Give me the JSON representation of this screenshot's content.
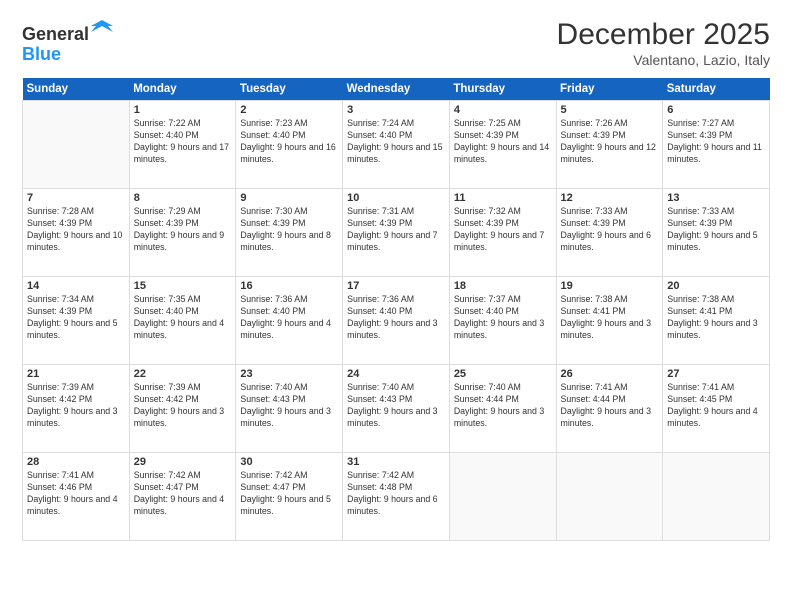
{
  "logo": {
    "general": "General",
    "blue": "Blue"
  },
  "header": {
    "month": "December 2025",
    "location": "Valentano, Lazio, Italy"
  },
  "weekdays": [
    "Sunday",
    "Monday",
    "Tuesday",
    "Wednesday",
    "Thursday",
    "Friday",
    "Saturday"
  ],
  "days": [
    {
      "date": "",
      "info": ""
    },
    {
      "date": "1",
      "info": "Sunrise: 7:22 AM\nSunset: 4:40 PM\nDaylight: 9 hours\nand 17 minutes."
    },
    {
      "date": "2",
      "info": "Sunrise: 7:23 AM\nSunset: 4:40 PM\nDaylight: 9 hours\nand 16 minutes."
    },
    {
      "date": "3",
      "info": "Sunrise: 7:24 AM\nSunset: 4:40 PM\nDaylight: 9 hours\nand 15 minutes."
    },
    {
      "date": "4",
      "info": "Sunrise: 7:25 AM\nSunset: 4:39 PM\nDaylight: 9 hours\nand 14 minutes."
    },
    {
      "date": "5",
      "info": "Sunrise: 7:26 AM\nSunset: 4:39 PM\nDaylight: 9 hours\nand 12 minutes."
    },
    {
      "date": "6",
      "info": "Sunrise: 7:27 AM\nSunset: 4:39 PM\nDaylight: 9 hours\nand 11 minutes."
    },
    {
      "date": "7",
      "info": "Sunrise: 7:28 AM\nSunset: 4:39 PM\nDaylight: 9 hours\nand 10 minutes."
    },
    {
      "date": "8",
      "info": "Sunrise: 7:29 AM\nSunset: 4:39 PM\nDaylight: 9 hours\nand 9 minutes."
    },
    {
      "date": "9",
      "info": "Sunrise: 7:30 AM\nSunset: 4:39 PM\nDaylight: 9 hours\nand 8 minutes."
    },
    {
      "date": "10",
      "info": "Sunrise: 7:31 AM\nSunset: 4:39 PM\nDaylight: 9 hours\nand 7 minutes."
    },
    {
      "date": "11",
      "info": "Sunrise: 7:32 AM\nSunset: 4:39 PM\nDaylight: 9 hours\nand 7 minutes."
    },
    {
      "date": "12",
      "info": "Sunrise: 7:33 AM\nSunset: 4:39 PM\nDaylight: 9 hours\nand 6 minutes."
    },
    {
      "date": "13",
      "info": "Sunrise: 7:33 AM\nSunset: 4:39 PM\nDaylight: 9 hours\nand 5 minutes."
    },
    {
      "date": "14",
      "info": "Sunrise: 7:34 AM\nSunset: 4:39 PM\nDaylight: 9 hours\nand 5 minutes."
    },
    {
      "date": "15",
      "info": "Sunrise: 7:35 AM\nSunset: 4:40 PM\nDaylight: 9 hours\nand 4 minutes."
    },
    {
      "date": "16",
      "info": "Sunrise: 7:36 AM\nSunset: 4:40 PM\nDaylight: 9 hours\nand 4 minutes."
    },
    {
      "date": "17",
      "info": "Sunrise: 7:36 AM\nSunset: 4:40 PM\nDaylight: 9 hours\nand 3 minutes."
    },
    {
      "date": "18",
      "info": "Sunrise: 7:37 AM\nSunset: 4:40 PM\nDaylight: 9 hours\nand 3 minutes."
    },
    {
      "date": "19",
      "info": "Sunrise: 7:38 AM\nSunset: 4:41 PM\nDaylight: 9 hours\nand 3 minutes."
    },
    {
      "date": "20",
      "info": "Sunrise: 7:38 AM\nSunset: 4:41 PM\nDaylight: 9 hours\nand 3 minutes."
    },
    {
      "date": "21",
      "info": "Sunrise: 7:39 AM\nSunset: 4:42 PM\nDaylight: 9 hours\nand 3 minutes."
    },
    {
      "date": "22",
      "info": "Sunrise: 7:39 AM\nSunset: 4:42 PM\nDaylight: 9 hours\nand 3 minutes."
    },
    {
      "date": "23",
      "info": "Sunrise: 7:40 AM\nSunset: 4:43 PM\nDaylight: 9 hours\nand 3 minutes."
    },
    {
      "date": "24",
      "info": "Sunrise: 7:40 AM\nSunset: 4:43 PM\nDaylight: 9 hours\nand 3 minutes."
    },
    {
      "date": "25",
      "info": "Sunrise: 7:40 AM\nSunset: 4:44 PM\nDaylight: 9 hours\nand 3 minutes."
    },
    {
      "date": "26",
      "info": "Sunrise: 7:41 AM\nSunset: 4:44 PM\nDaylight: 9 hours\nand 3 minutes."
    },
    {
      "date": "27",
      "info": "Sunrise: 7:41 AM\nSunset: 4:45 PM\nDaylight: 9 hours\nand 4 minutes."
    },
    {
      "date": "28",
      "info": "Sunrise: 7:41 AM\nSunset: 4:46 PM\nDaylight: 9 hours\nand 4 minutes."
    },
    {
      "date": "29",
      "info": "Sunrise: 7:42 AM\nSunset: 4:47 PM\nDaylight: 9 hours\nand 4 minutes."
    },
    {
      "date": "30",
      "info": "Sunrise: 7:42 AM\nSunset: 4:47 PM\nDaylight: 9 hours\nand 5 minutes."
    },
    {
      "date": "31",
      "info": "Sunrise: 7:42 AM\nSunset: 4:48 PM\nDaylight: 9 hours\nand 6 minutes."
    },
    {
      "date": "",
      "info": ""
    },
    {
      "date": "",
      "info": ""
    },
    {
      "date": "",
      "info": ""
    },
    {
      "date": "",
      "info": ""
    },
    {
      "date": "",
      "info": ""
    },
    {
      "date": "",
      "info": ""
    }
  ]
}
